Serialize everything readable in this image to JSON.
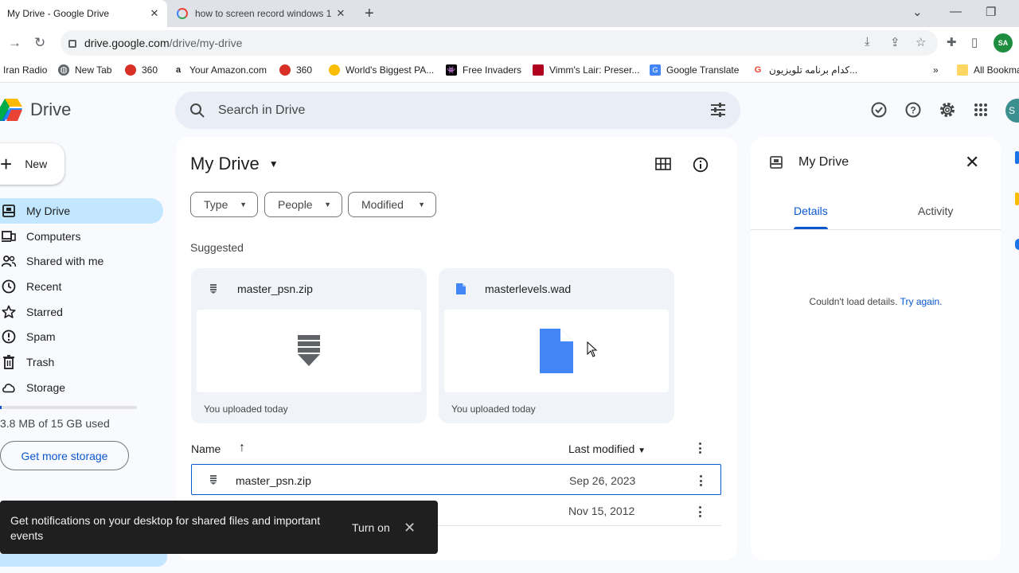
{
  "browser": {
    "tabs": [
      {
        "title": "My Drive - Google Drive"
      },
      {
        "title": "how to screen record windows 1"
      }
    ],
    "url_host": "drive.google.com",
    "url_path": "/drive/my-drive",
    "profile_initials": "SA",
    "bookmarks": [
      "Iran Radio",
      "New Tab",
      "360",
      "Your Amazon.com",
      "360",
      "World's Biggest PA...",
      "Free Invaders",
      "Vimm's Lair: Preser...",
      "Google Translate",
      "کدام برنامه تلویزیون...",
      "All Bookma"
    ],
    "bookmarks_more": "»"
  },
  "app": {
    "name": "Drive",
    "search_placeholder": "Search in Drive",
    "user_initials": "S"
  },
  "sidebar": {
    "new_label": "New",
    "items": [
      {
        "label": "My Drive",
        "icon": "my-drive-icon"
      },
      {
        "label": "Computers",
        "icon": "computers-icon"
      },
      {
        "label": "Shared with me",
        "icon": "shared-icon"
      },
      {
        "label": "Recent",
        "icon": "clock-icon"
      },
      {
        "label": "Starred",
        "icon": "star-icon"
      },
      {
        "label": "Spam",
        "icon": "spam-icon"
      },
      {
        "label": "Trash",
        "icon": "trash-icon"
      },
      {
        "label": "Storage",
        "icon": "cloud-icon"
      }
    ],
    "storage_used_fraction": 0.0003,
    "storage_text": "3.8 MB of 15 GB used",
    "get_storage": "Get more storage"
  },
  "main": {
    "title": "My Drive",
    "filters": [
      "Type",
      "People",
      "Modified"
    ],
    "suggested_label": "Suggested",
    "suggested": [
      {
        "name": "master_psn.zip",
        "subtitle": "You uploaded today"
      },
      {
        "name": "masterlevels.wad",
        "subtitle": "You uploaded today"
      }
    ],
    "columns": {
      "name": "Name",
      "modified": "Last modified"
    },
    "rows": [
      {
        "name": "master_psn.zip",
        "modified": "Sep 26, 2023"
      },
      {
        "name": "",
        "modified": "Nov 15, 2012"
      }
    ]
  },
  "details": {
    "title": "My Drive",
    "tabs": [
      "Details",
      "Activity"
    ],
    "error_text": "Couldn't load details.",
    "retry_link": "Try again."
  },
  "snackbar": {
    "message": "Get notifications on your desktop for shared files and important events",
    "action": "Turn on"
  },
  "colors": {
    "accent": "#0b57d0",
    "active_nav": "#c2e7ff",
    "search_bg": "#e9eef6",
    "page_bg": "#f8fafd"
  }
}
